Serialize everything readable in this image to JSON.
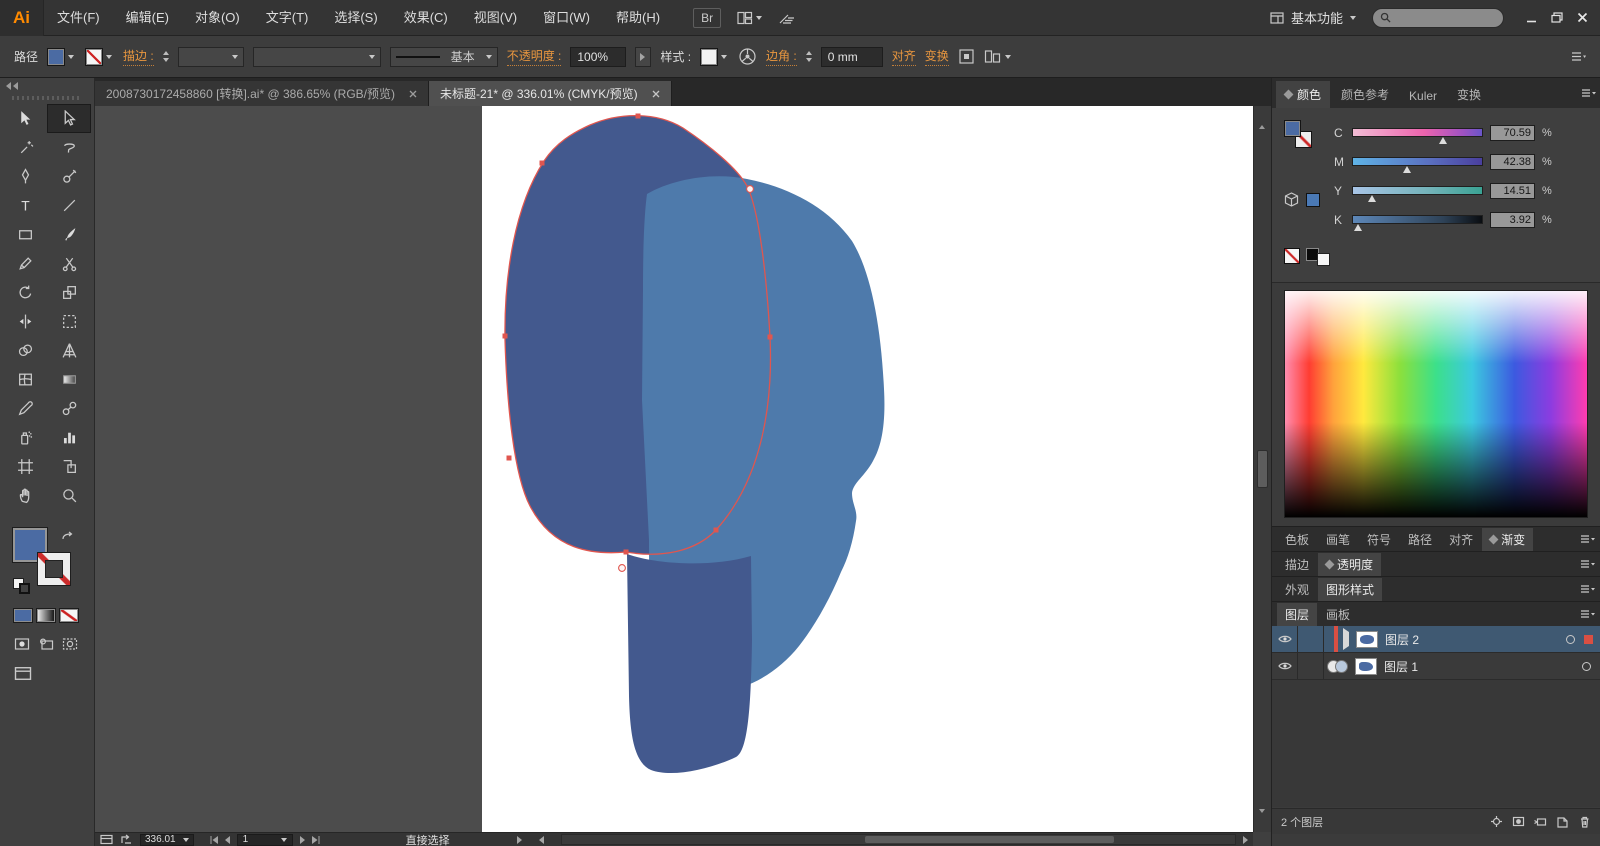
{
  "window": {
    "logo": "Ai",
    "workspace": "基本功能"
  },
  "menu": {
    "items": [
      "文件(F)",
      "编辑(E)",
      "对象(O)",
      "文字(T)",
      "选择(S)",
      "效果(C)",
      "视图(V)",
      "窗口(W)",
      "帮助(H)"
    ],
    "bridge_label": "Br"
  },
  "control_bar": {
    "object_label": "路径",
    "stroke_label": "描边 :",
    "line_style_label": "基本",
    "opacity_label": "不透明度 :",
    "opacity_value": "100%",
    "style_label": "样式 :",
    "corner_label": "边角 :",
    "corner_value": "0 mm",
    "align_link": "对齐",
    "transform_link": "变换"
  },
  "document_tabs": [
    {
      "title": "2008730172458860 [转换].ai* @ 386.65% (RGB/预览)"
    },
    {
      "title": "未标题-21* @ 336.01% (CMYK/预览)"
    }
  ],
  "toolbar_tools": [
    "selection",
    "direct-selection",
    "magic-wand",
    "lasso",
    "pen",
    "blob-brush",
    "type",
    "line-segment",
    "rectangle",
    "paintbrush",
    "pencil",
    "scissors",
    "rotate",
    "scale",
    "width",
    "free-transform",
    "shape-builder",
    "perspective-grid",
    "mesh",
    "gradient",
    "eyedropper",
    "blend",
    "symbol-sprayer",
    "column-graph",
    "artboard",
    "slice",
    "hand",
    "zoom"
  ],
  "color_panel": {
    "tabs": [
      "颜色",
      "颜色参考",
      "Kuler",
      "变换"
    ],
    "channels": [
      {
        "label": "C",
        "value": "70.59",
        "percent": 70
      },
      {
        "label": "M",
        "value": "42.38",
        "percent": 42
      },
      {
        "label": "Y",
        "value": "14.51",
        "percent": 15
      },
      {
        "label": "K",
        "value": "3.92",
        "percent": 4
      }
    ],
    "unit": "%"
  },
  "panel_groups": {
    "row1": [
      "色板",
      "画笔",
      "符号",
      "路径",
      "对齐",
      "渐变"
    ],
    "row2": [
      "描边",
      "透明度"
    ],
    "row3": [
      "外观",
      "图形样式"
    ],
    "row4": [
      "图层",
      "画板"
    ]
  },
  "layers_panel": {
    "layers": [
      {
        "name": "图层 2",
        "selected": true
      },
      {
        "name": "图层 1",
        "selected": false
      }
    ],
    "count_label": "2 个图层"
  },
  "status_bar": {
    "zoom": "336.01",
    "artboard": "1",
    "tool_name": "直接选择"
  },
  "canvas_colors": {
    "dark_shape": "#43598e",
    "light_shape": "#4e7aab",
    "selection_path": "#e0564f"
  }
}
